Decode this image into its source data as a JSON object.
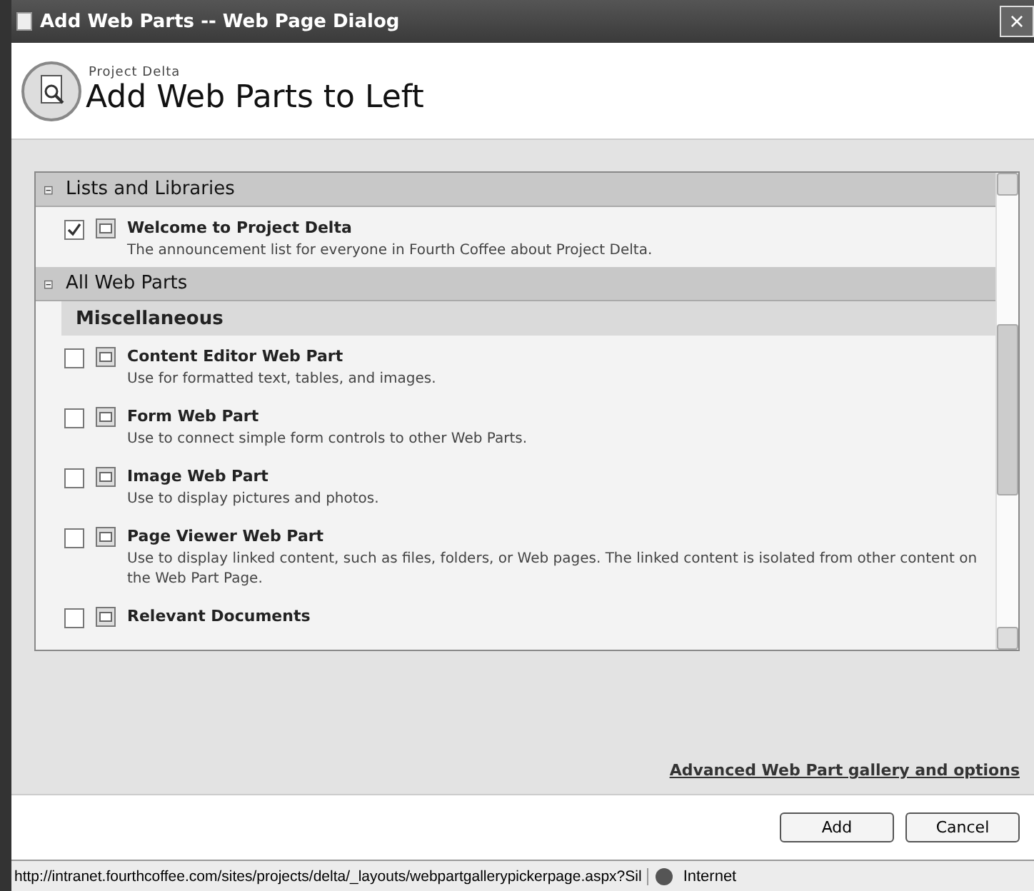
{
  "window": {
    "title": "Add Web Parts -- Web Page Dialog",
    "close": "×"
  },
  "header": {
    "site": "Project Delta",
    "title": "Add Web Parts to Left"
  },
  "sections": [
    {
      "title": "Lists and Libraries",
      "expanded": true,
      "groups": [
        {
          "items": [
            {
              "name": "Welcome to Project Delta",
              "description": "The announcement list for everyone in Fourth Coffee about Project Delta.",
              "checked": true
            }
          ]
        }
      ]
    },
    {
      "title": "All Web Parts",
      "expanded": true,
      "groups": [
        {
          "title": "Miscellaneous",
          "items": [
            {
              "name": "Content Editor Web Part",
              "description": "Use for formatted text, tables, and images.",
              "checked": false
            },
            {
              "name": "Form Web Part",
              "description": "Use to connect simple form controls to other Web Parts.",
              "checked": false
            },
            {
              "name": "Image Web Part",
              "description": "Use to display pictures and photos.",
              "checked": false
            },
            {
              "name": "Page Viewer Web Part",
              "description": "Use to display linked content, such as files, folders, or Web pages. The linked content is isolated from other content on the Web Part Page.",
              "checked": false
            },
            {
              "name": "Relevant Documents",
              "checked": false
            }
          ]
        }
      ]
    }
  ],
  "advanced_link": "Advanced Web Part gallery and options",
  "buttons": [
    "Add",
    "Cancel"
  ],
  "status_bar": {
    "url": "http://intranet.fourthcoffee.com/sites/projects/delta/_layouts/webpartgallerypickerpage.aspx?Sil",
    "zone": "Internet"
  }
}
